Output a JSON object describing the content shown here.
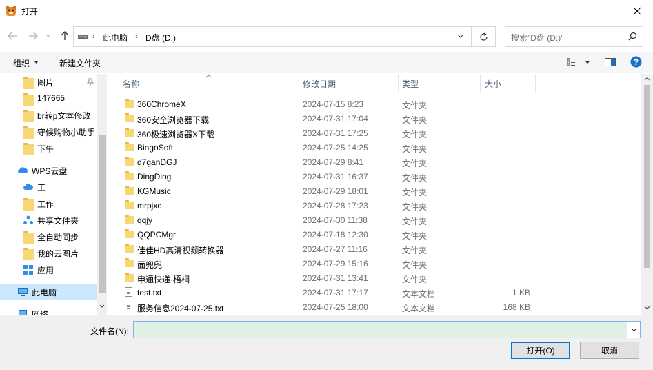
{
  "window": {
    "title": "打开",
    "close_glyph": "✕"
  },
  "address": {
    "breadcrumb": [
      "此电脑",
      "D盘 (D:)"
    ],
    "search_placeholder": "搜索\"D盘 (D:)\""
  },
  "toolbar": {
    "organize": "组织",
    "new_folder": "新建文件夹"
  },
  "sidebar": {
    "items": [
      {
        "label": "图片",
        "icon": "folder-icon",
        "pinned": true
      },
      {
        "label": "147665",
        "icon": "folder-icon"
      },
      {
        "label": "br转p文本修改",
        "icon": "folder-icon"
      },
      {
        "label": "守候购物小助手",
        "icon": "folder-icon"
      },
      {
        "label": "下午",
        "icon": "folder-icon"
      },
      {
        "label": "WPS云盘",
        "icon": "cloud-icon"
      },
      {
        "label": "工",
        "icon": "cloud-icon"
      },
      {
        "label": "工作",
        "icon": "folder-icon"
      },
      {
        "label": "共享文件夹",
        "icon": "share-icon"
      },
      {
        "label": "全自动同步",
        "icon": "folder-icon"
      },
      {
        "label": "我的云图片",
        "icon": "folder-icon"
      },
      {
        "label": "应用",
        "icon": "apps-icon"
      },
      {
        "label": "此电脑",
        "icon": "computer-icon",
        "selected": true
      },
      {
        "label": "网络",
        "icon": "network-icon"
      }
    ]
  },
  "columns": {
    "name": "名称",
    "date": "修改日期",
    "type": "类型",
    "size": "大小"
  },
  "files": [
    {
      "name": "360ChromeX",
      "date": "2024-07-15 8:23",
      "type": "文件夹",
      "size": "",
      "kind": "folder"
    },
    {
      "name": "360安全浏览器下载",
      "date": "2024-07-31 17:04",
      "type": "文件夹",
      "size": "",
      "kind": "folder"
    },
    {
      "name": "360极速浏览器X下载",
      "date": "2024-07-31 17:25",
      "type": "文件夹",
      "size": "",
      "kind": "folder"
    },
    {
      "name": "BingoSoft",
      "date": "2024-07-25 14:25",
      "type": "文件夹",
      "size": "",
      "kind": "folder"
    },
    {
      "name": "d7ganDGJ",
      "date": "2024-07-29 8:41",
      "type": "文件夹",
      "size": "",
      "kind": "folder"
    },
    {
      "name": "DingDing",
      "date": "2024-07-31 16:37",
      "type": "文件夹",
      "size": "",
      "kind": "folder"
    },
    {
      "name": "KGMusic",
      "date": "2024-07-29 18:01",
      "type": "文件夹",
      "size": "",
      "kind": "folder"
    },
    {
      "name": "mrpjxc",
      "date": "2024-07-28 17:23",
      "type": "文件夹",
      "size": "",
      "kind": "folder"
    },
    {
      "name": "qqjy",
      "date": "2024-07-30 11:38",
      "type": "文件夹",
      "size": "",
      "kind": "folder"
    },
    {
      "name": "QQPCMgr",
      "date": "2024-07-18 12:30",
      "type": "文件夹",
      "size": "",
      "kind": "folder"
    },
    {
      "name": "佳佳HD高清视频转换器",
      "date": "2024-07-27 11:16",
      "type": "文件夹",
      "size": "",
      "kind": "folder"
    },
    {
      "name": "面兜兜",
      "date": "2024-07-29 15:16",
      "type": "文件夹",
      "size": "",
      "kind": "folder"
    },
    {
      "name": "申通快递·梧桐",
      "date": "2024-07-31 13:41",
      "type": "文件夹",
      "size": "",
      "kind": "folder"
    },
    {
      "name": "test.txt",
      "date": "2024-07-31 17:17",
      "type": "文本文档",
      "size": "1 KB",
      "kind": "doc"
    },
    {
      "name": "服务信息2024-07-25.txt",
      "date": "2024-07-25 18:00",
      "type": "文本文档",
      "size": "168 KB",
      "kind": "doc"
    }
  ],
  "bottom": {
    "filename_label": "文件名(N):",
    "filename_value": "",
    "open": "打开(O)",
    "cancel": "取消"
  }
}
